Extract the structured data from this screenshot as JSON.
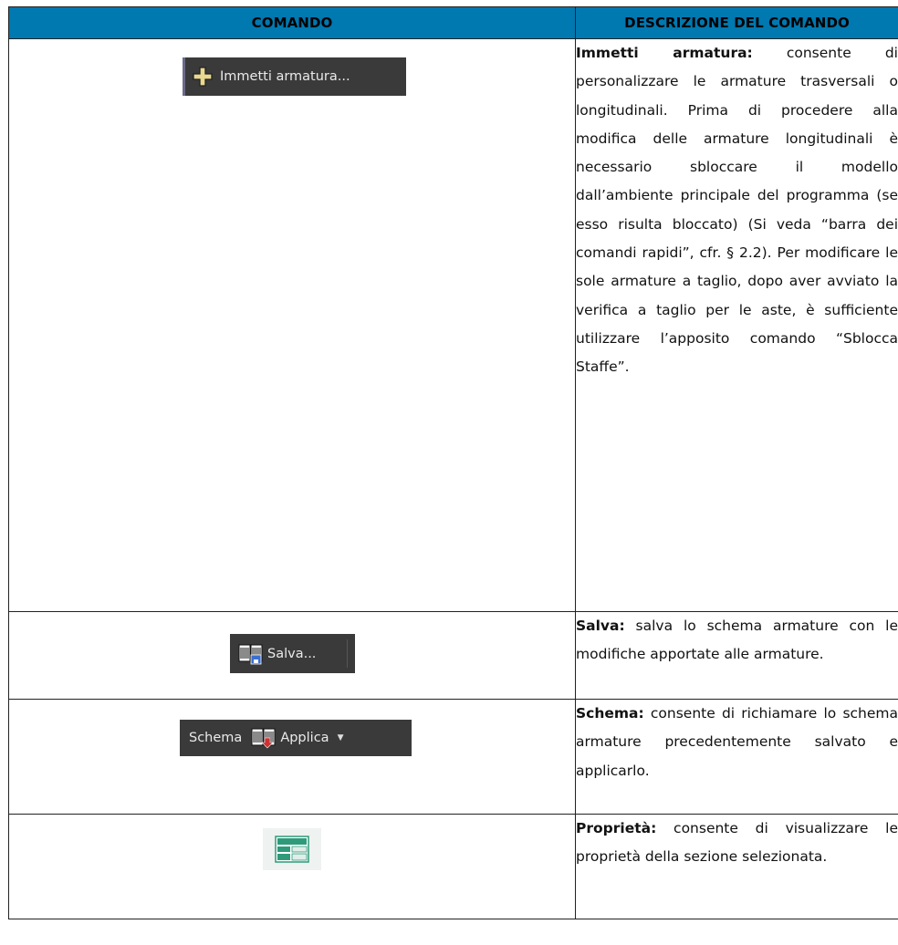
{
  "headers": {
    "col1": "COMANDO",
    "col2": "DESCRIZIONE DEL COMANDO"
  },
  "rows": [
    {
      "button_label": "Immetti armatura...",
      "button_icon": "plus-icon",
      "title": "Immetti armatura:",
      "text": " consente di personalizzare le armature trasversali o longitudinali. Prima di procedere alla modifica delle armature longitudinali è necessario sbloccare il modello dall’ambiente principale del programma (se esso risulta bloccato) (Si veda “barra dei comandi rapidi”, cfr. § 2.2). Per modificare le sole armature a taglio, dopo aver avviato la verifica a taglio per le aste, è sufficiente utilizzare l’apposito comando “Sblocca Staffe”."
    },
    {
      "button_label": "Salva...",
      "button_icon": "save-scheme-icon",
      "title": "Salva:",
      "text": " salva lo schema armature con le modifiche apportate alle armature."
    },
    {
      "button_prefix": "Schema",
      "button_label": "Applica",
      "button_icon": "apply-scheme-icon",
      "title": "Schema:",
      "text": " consente di richiamare lo schema armature precedentemente salvato e applicarlo."
    },
    {
      "button_icon": "properties-icon",
      "title": "Proprietà:",
      "text": " consente di visualizzare le proprietà della sezione selezionata."
    }
  ],
  "colors": {
    "header_bg": "#0078b0",
    "button_bg": "#3a3a3a",
    "icon_green": "#2f9a7a"
  }
}
